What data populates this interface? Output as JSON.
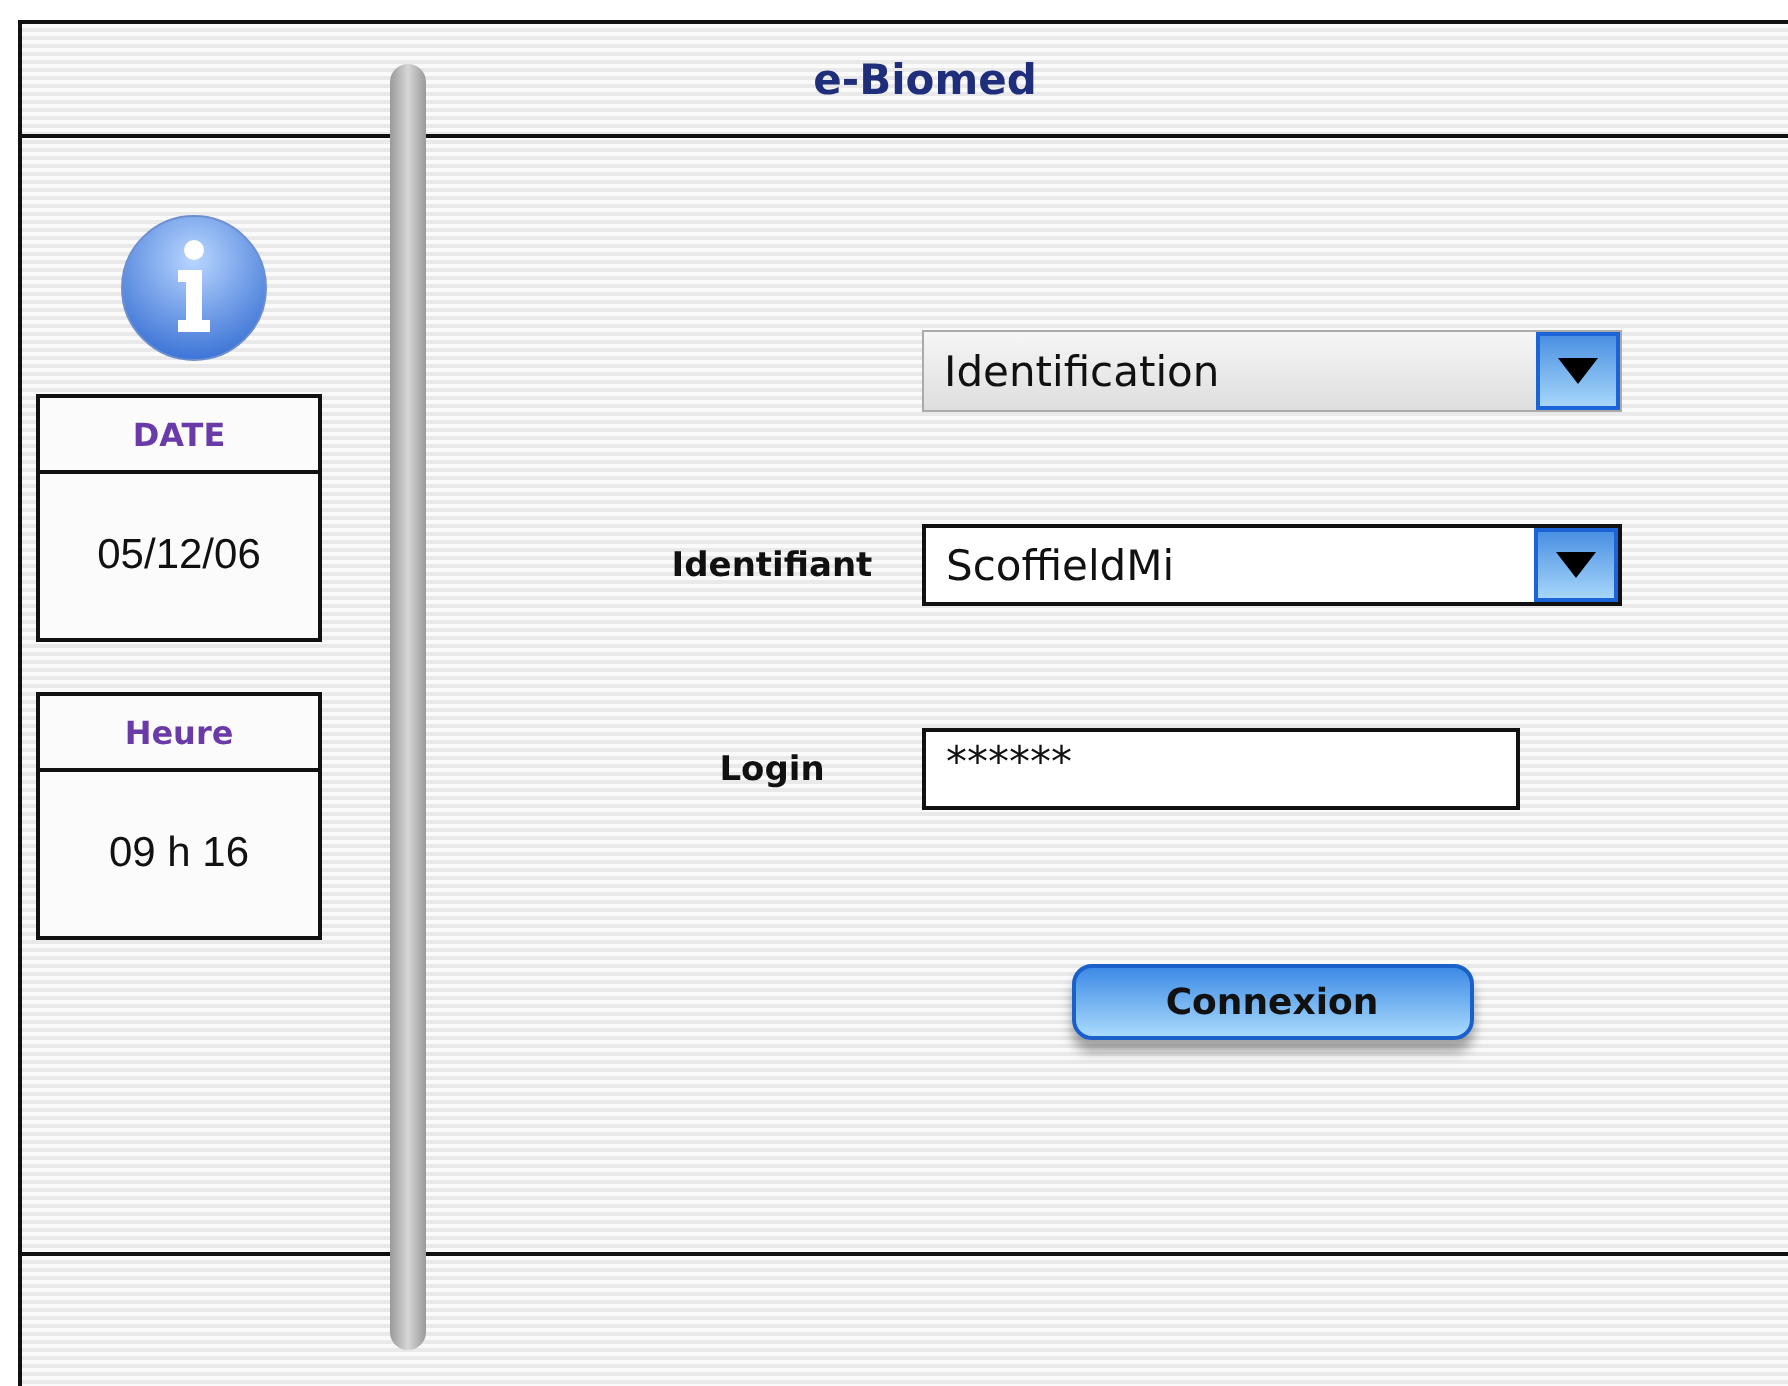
{
  "window": {
    "title": "e-Biomed"
  },
  "sidebar": {
    "date": {
      "label": "DATE",
      "value": "05/12/06"
    },
    "time": {
      "label": "Heure",
      "value": "09 h 16"
    }
  },
  "form": {
    "mode_select": {
      "value": "Identification"
    },
    "identifiant": {
      "label": "Identifiant",
      "value": "ScoffieldMi"
    },
    "login": {
      "label": "Login",
      "value": "******"
    },
    "connect_button": "Connexion"
  }
}
